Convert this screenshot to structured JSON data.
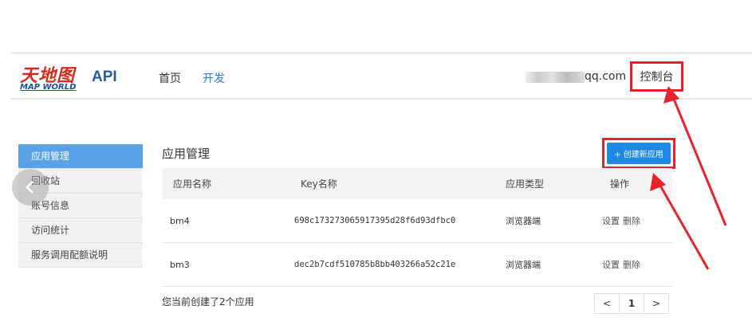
{
  "header": {
    "logo_cn": "天地图",
    "logo_en": "MAP WORLD",
    "api_title": "API",
    "nav": [
      {
        "label": "首页"
      },
      {
        "label": "开发"
      }
    ],
    "user_suffix": "qq.com",
    "console_label": "控制台"
  },
  "sidebar": {
    "items": [
      {
        "label": "应用管理"
      },
      {
        "label": "回收站"
      },
      {
        "label": "账号信息"
      },
      {
        "label": "访问统计"
      },
      {
        "label": "服务调用配额说明"
      }
    ]
  },
  "main": {
    "title": "应用管理",
    "create_label": "+ 创建新应用",
    "columns": [
      "应用名称",
      "Key名称",
      "应用类型",
      "操作"
    ],
    "rows": [
      {
        "name": "bm4",
        "key": "698c173273065917395d28f6d93dfbc0",
        "type": "浏览器端",
        "settings": "设置",
        "delete": "删除"
      },
      {
        "name": "bm3",
        "key": "dec2b7cdf510785b8bb403266a52c21e",
        "type": "浏览器端",
        "settings": "设置",
        "delete": "删除"
      }
    ],
    "count_text": "您当前创建了2个应用",
    "pager": {
      "prev": "<",
      "current": "1",
      "next": ">"
    }
  },
  "colors": {
    "accent": "#1e88e5",
    "sidebar_active": "#5aa2e8",
    "highlight_red": "#e8222a"
  }
}
